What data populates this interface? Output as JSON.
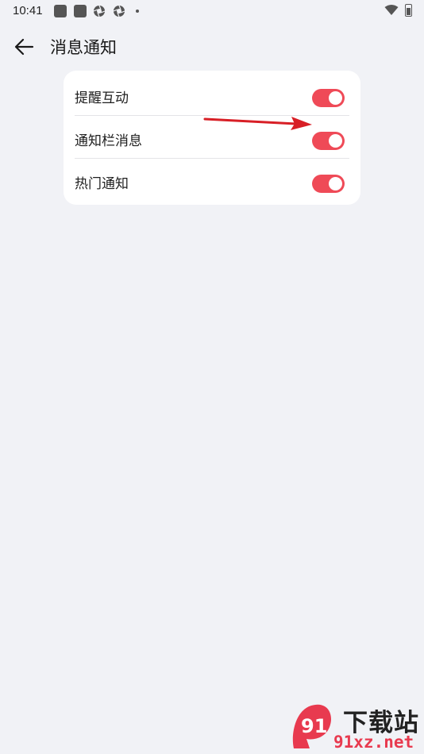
{
  "status_bar": {
    "time": "10:41",
    "notification_icons": [
      "app-square-icon",
      "app-square-icon",
      "aperture-icon",
      "aperture-icon",
      "dot-icon"
    ],
    "right_icons": [
      "wifi-icon",
      "battery-charging-icon"
    ]
  },
  "header": {
    "title": "消息通知",
    "back_icon": "arrow-left-icon"
  },
  "settings": {
    "items": [
      {
        "label": "提醒互动",
        "enabled": true
      },
      {
        "label": "通知栏消息",
        "enabled": true
      },
      {
        "label": "热门通知",
        "enabled": true
      }
    ]
  },
  "colors": {
    "accent": "#ef4a57",
    "background": "#f1f2f6",
    "card": "#ffffff",
    "annotation_arrow": "#d81f26"
  },
  "watermark": {
    "top_text": "下载站",
    "bottom_text": "91xz.net",
    "logo_text": "91"
  }
}
